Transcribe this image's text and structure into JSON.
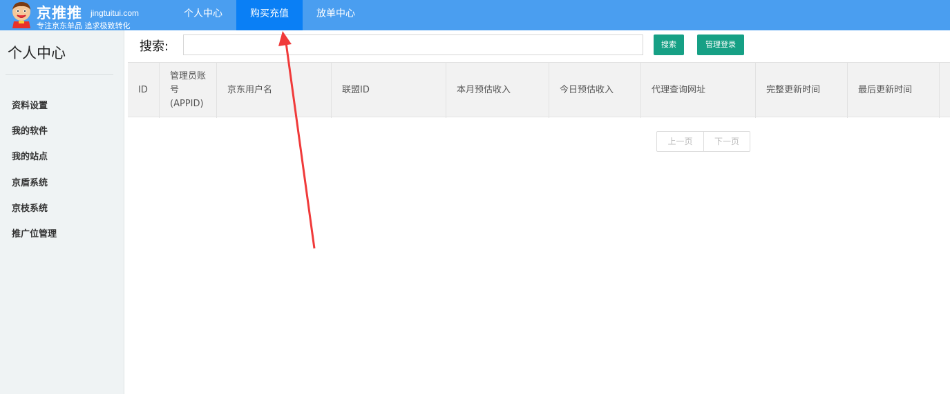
{
  "brand": {
    "name": "京推推",
    "domain": "jingtuitui.com",
    "slogan": "专注京东单品 追求极致转化"
  },
  "nav": {
    "items": [
      {
        "label": "个人中心"
      },
      {
        "label": "购买充值"
      },
      {
        "label": "放单中心"
      }
    ],
    "active": "购买充值"
  },
  "sidebar": {
    "title": "个人中心",
    "items": [
      {
        "label": "资料设置"
      },
      {
        "label": "我的软件"
      },
      {
        "label": "我的站点"
      },
      {
        "label": "京盾系统"
      },
      {
        "label": "京枝系统"
      },
      {
        "label": "推广位管理"
      }
    ]
  },
  "search": {
    "label": "搜索:",
    "value": "",
    "placeholder": "",
    "button_label": "搜索",
    "admin_login_label": "管理登录"
  },
  "table": {
    "columns": [
      "ID",
      "管理员账号(APPID)",
      "京东用户名",
      "联盟ID",
      "本月预估收入",
      "今日预估收入",
      "代理查询网址",
      "完整更新时间",
      "最后更新时间"
    ],
    "rows": []
  },
  "pagination": {
    "prev_label": "上一页",
    "next_label": "下一页"
  },
  "colors": {
    "topbar": "#4a9ef0",
    "nav_active": "#0a7ff5",
    "button": "#16a085",
    "sidebar_bg": "#eff3f4",
    "annotation_arrow": "#f03a3a"
  }
}
